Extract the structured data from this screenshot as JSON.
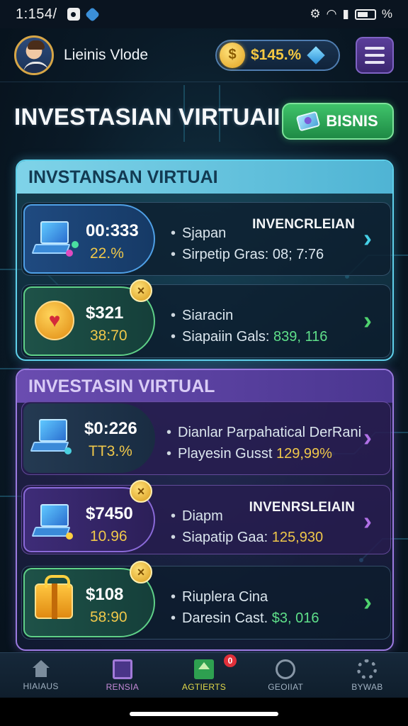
{
  "status_bar": {
    "time": "1:154/",
    "battery_percent": "%"
  },
  "header": {
    "user_name": "Lieinis Vlode",
    "coin_symbol": "$",
    "balance": "$145.%"
  },
  "page": {
    "title": "INVESTASIAN VIRTUAII",
    "bisnis_button": "BISNIS"
  },
  "sections": [
    {
      "title": "INVSTANSAN VIRTUAI",
      "cards": [
        {
          "amount": "00:333",
          "sub": "22.%",
          "line1": "Sjapan",
          "line2_label": "Sirpetip Gras:",
          "line2_value": "08; 7:76",
          "tag": "INVENCRLEIAN"
        },
        {
          "amount": "$321",
          "sub": "38:70",
          "line1": "Siaracin",
          "line2_label": "Siapaiin Gals:",
          "line2_value": "839, 116",
          "badge": "×"
        }
      ]
    },
    {
      "title": "INVESTASIN VIRTUAL",
      "cards": [
        {
          "amount": "$0:226",
          "sub": "TT3.%",
          "line1": "Dianlar Parpahatical DerRani",
          "line2_label": "Playesin Gusst",
          "line2_value": "129,99%"
        },
        {
          "amount": "$7450",
          "sub": "10.96",
          "line1": "Diapm",
          "line2_label": "Siapatip Gaa:",
          "line2_value": "125,930",
          "tag": "INVENRSLEIAIN",
          "badge": "×"
        },
        {
          "amount": "$108",
          "sub": "58:90",
          "line1": "Riuplera Cina",
          "line2_label": "Daresin Cast.",
          "line2_value": "$3, 016",
          "badge": "×"
        }
      ]
    }
  ],
  "bullet": "•",
  "chevron": "›",
  "nav": {
    "items": [
      {
        "label": "HIAIAUS"
      },
      {
        "label": "RENSIA"
      },
      {
        "label": "AGTIERTS"
      },
      {
        "label": "GEOIIAT",
        "badge": "0"
      },
      {
        "label": "BYWAB"
      }
    ]
  },
  "colors": {
    "accent_gold": "#f0c84a",
    "accent_green": "#4fd26e",
    "accent_cyan": "#46d0e6",
    "accent_purple": "#b070e6"
  }
}
